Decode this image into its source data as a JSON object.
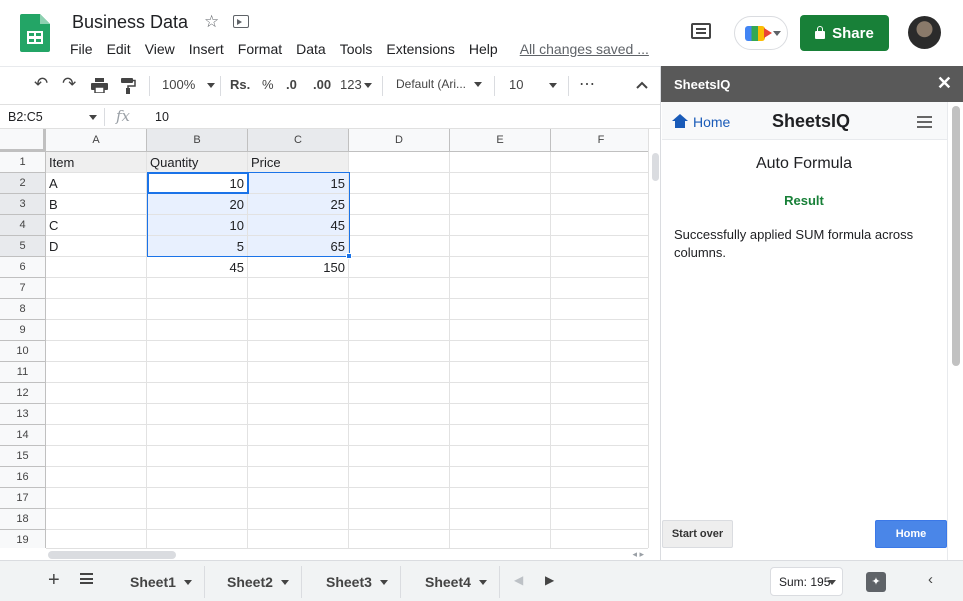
{
  "header": {
    "doc_title": "Business Data",
    "menu": [
      "File",
      "Edit",
      "View",
      "Insert",
      "Format",
      "Data",
      "Tools",
      "Extensions",
      "Help"
    ],
    "save_status": "All changes saved ...",
    "share_label": "Share",
    "accent": "#188038"
  },
  "toolbar": {
    "zoom": "100%",
    "currency": "Rs.",
    "percent": "%",
    "decrease_decimals": ".0",
    "increase_decimals": ".00",
    "more_formats": "123",
    "font": "Default (Ari...",
    "font_size": "10",
    "more": "⋯"
  },
  "formula_bar": {
    "name_box": "B2:C5",
    "fx": "fx",
    "value": "10"
  },
  "grid": {
    "columns": [
      "A",
      "B",
      "C",
      "D",
      "E",
      "F"
    ],
    "rows": [
      "1",
      "2",
      "3",
      "4",
      "5",
      "6",
      "7",
      "8",
      "9",
      "10",
      "11",
      "12",
      "13",
      "14",
      "15",
      "16",
      "17",
      "18",
      "19"
    ],
    "cells": [
      [
        "Item",
        "Quantity",
        "Price"
      ],
      [
        "A",
        "10",
        "15"
      ],
      [
        "B",
        "20",
        "25"
      ],
      [
        "C",
        "10",
        "45"
      ],
      [
        "D",
        "5",
        "65"
      ],
      [
        "",
        "45",
        "150"
      ]
    ],
    "selection_range": "B2:C5"
  },
  "sheets": {
    "tabs": [
      "Sheet1",
      "Sheet2",
      "Sheet3",
      "Sheet4"
    ],
    "active": "Sheet1",
    "sum": "Sum: 195"
  },
  "panel": {
    "header_title": "SheetsIQ",
    "close": "✕",
    "home_link": "Home",
    "brand": "SheetsIQ",
    "heading": "Auto Formula",
    "result_label": "Result",
    "message": "Successfully applied SUM formula across columns.",
    "start_over": "Start over",
    "home_button": "Home",
    "result_color": "#188038",
    "button_color": "#4a86e8"
  },
  "icons": {
    "undo": "↶",
    "redo": "↷",
    "star": "☆",
    "add_sheet": "+",
    "nav_prev": "◀",
    "nav_next": "▶",
    "collapse": "‹"
  }
}
